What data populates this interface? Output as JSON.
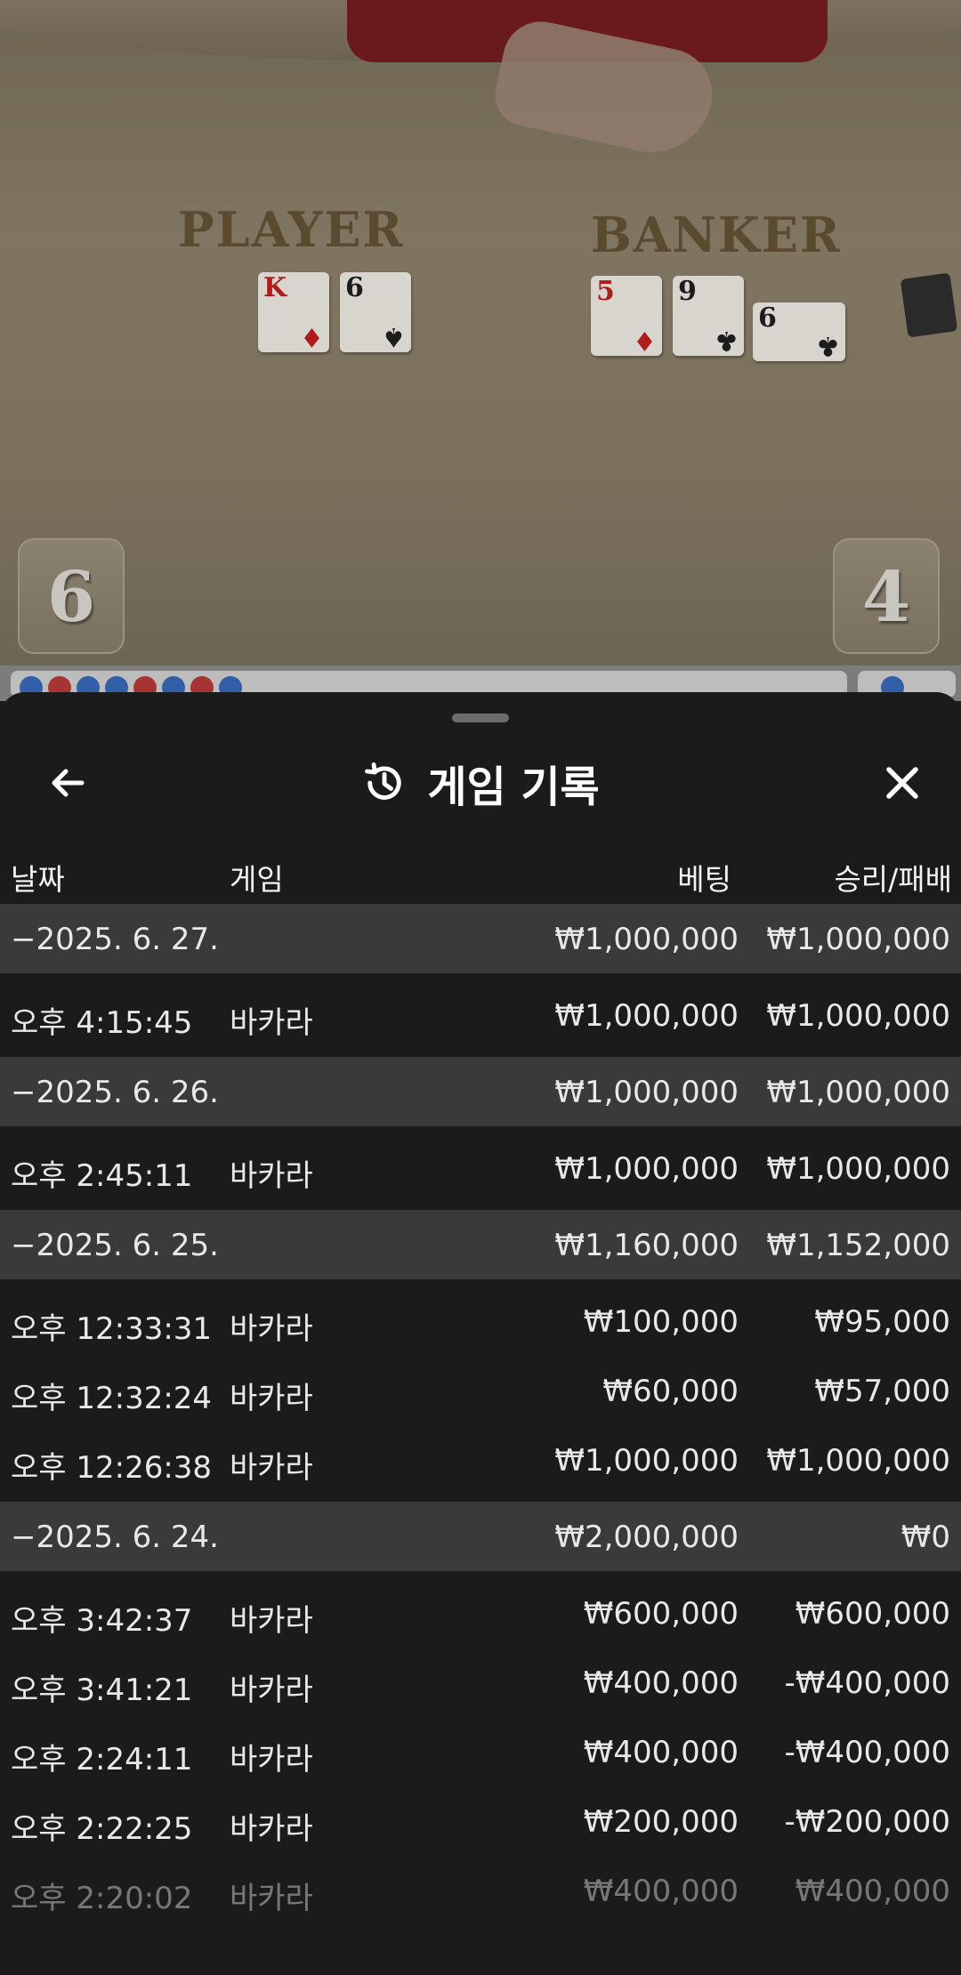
{
  "video": {
    "player_label": "PLAYER",
    "banker_label": "BANKER",
    "player_score": "6",
    "banker_score": "4",
    "player_cards": [
      {
        "rank": "K",
        "suit": "♦",
        "color": "red"
      },
      {
        "rank": "6",
        "suit": "♠",
        "color": "black"
      }
    ],
    "banker_cards": [
      {
        "rank": "5",
        "suit": "♦",
        "color": "red"
      },
      {
        "rank": "9",
        "suit": "♣",
        "color": "black"
      },
      {
        "rank": "6",
        "suit": "♣",
        "color": "black"
      }
    ]
  },
  "sheet": {
    "title": "게임 기록",
    "icons": {
      "back": "arrow-left-icon",
      "history": "history-icon",
      "close": "close-icon"
    },
    "columns": {
      "date": "날짜",
      "game": "게임",
      "bet": "베팅",
      "winloss": "승리/패배"
    }
  },
  "groups": [
    {
      "date": "−2025. 6. 27.",
      "bet": "₩1,000,000",
      "winloss": "₩1,000,000",
      "rows": [
        {
          "time": "오후 4:15:45",
          "game": "바카라",
          "bet": "₩1,000,000",
          "winloss": "₩1,000,000"
        }
      ]
    },
    {
      "date": "−2025. 6. 26.",
      "bet": "₩1,000,000",
      "winloss": "₩1,000,000",
      "rows": [
        {
          "time": "오후 2:45:11",
          "game": "바카라",
          "bet": "₩1,000,000",
          "winloss": "₩1,000,000"
        }
      ]
    },
    {
      "date": "−2025. 6. 25.",
      "bet": "₩1,160,000",
      "winloss": "₩1,152,000",
      "rows": [
        {
          "time": "오후 12:33:31",
          "game": "바카라",
          "bet": "₩100,000",
          "winloss": "₩95,000"
        },
        {
          "time": "오후 12:32:24",
          "game": "바카라",
          "bet": "₩60,000",
          "winloss": "₩57,000"
        },
        {
          "time": "오후 12:26:38",
          "game": "바카라",
          "bet": "₩1,000,000",
          "winloss": "₩1,000,000"
        }
      ]
    },
    {
      "date": "−2025. 6. 24.",
      "bet": "₩2,000,000",
      "winloss": "₩0",
      "rows": [
        {
          "time": "오후 3:42:37",
          "game": "바카라",
          "bet": "₩600,000",
          "winloss": "₩600,000"
        },
        {
          "time": "오후 3:41:21",
          "game": "바카라",
          "bet": "₩400,000",
          "winloss": "-₩400,000"
        },
        {
          "time": "오후 2:24:11",
          "game": "바카라",
          "bet": "₩400,000",
          "winloss": "-₩400,000"
        },
        {
          "time": "오후 2:22:25",
          "game": "바카라",
          "bet": "₩200,000",
          "winloss": "-₩200,000"
        },
        {
          "time": "오후 2:20:02",
          "game": "바카라",
          "bet": "₩400,000",
          "winloss": "₩400,000"
        }
      ]
    }
  ]
}
